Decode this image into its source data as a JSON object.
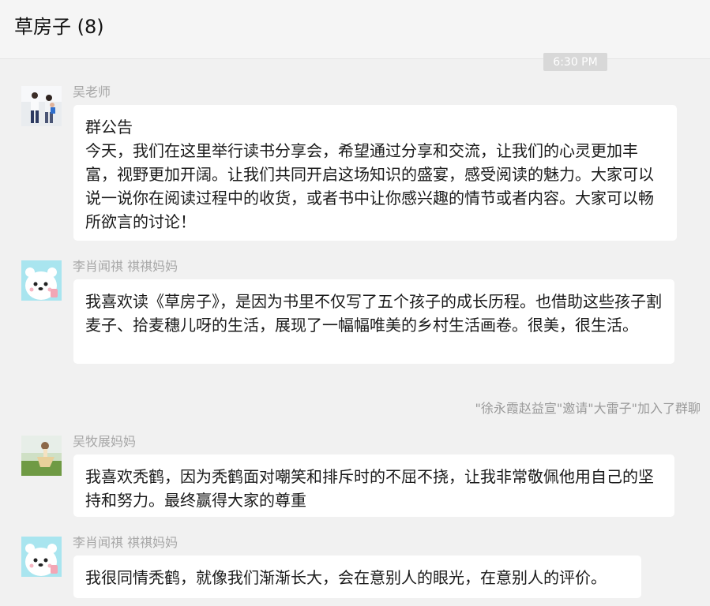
{
  "header": {
    "title": "草房子 (8)"
  },
  "timestamp": "6:30 PM",
  "messages": [
    {
      "sender": "吴老师",
      "avatar": "family-photo-avatar",
      "title": "群公告",
      "text": "今天，我们在这里举行读书分享会，希望通过分享和交流，让我们的心灵更加丰富，视野更加开阔。让我们共同开启这场知识的盛宴，感受阅读的魅力。大家可以说一说你在阅读过程中的收货，或者书中让你感兴趣的情节或者内容。大家可以畅所欲言的讨论！"
    },
    {
      "sender": "李肖闻祺 祺祺妈妈",
      "avatar": "cartoon-bear-avatar",
      "text": "我喜欢读《草房子》，是因为书里不仅写了五个孩子的成长历程。也借助这些孩子割麦子、拾麦穗儿呀的生活，展现了一幅幅唯美的乡村生活画卷。很美，很生活。"
    },
    {
      "sender": "吴牧展妈妈",
      "avatar": "field-photo-avatar",
      "text": "我喜欢秃鹤，因为秃鹤面对嘲笑和排斥时的不屈不挠，让我非常敬佩他用自己的坚持和努力。最终赢得大家的尊重"
    },
    {
      "sender": "李肖闻祺 祺祺妈妈",
      "avatar": "cartoon-bear-avatar",
      "text": "我很同情秃鹤，就像我们渐渐长大，会在意别人的眼光，在意别人的评价。"
    }
  ],
  "system_notice": "\"徐永霞赵益宣\"邀请\"大雷子\"加入了群聊"
}
